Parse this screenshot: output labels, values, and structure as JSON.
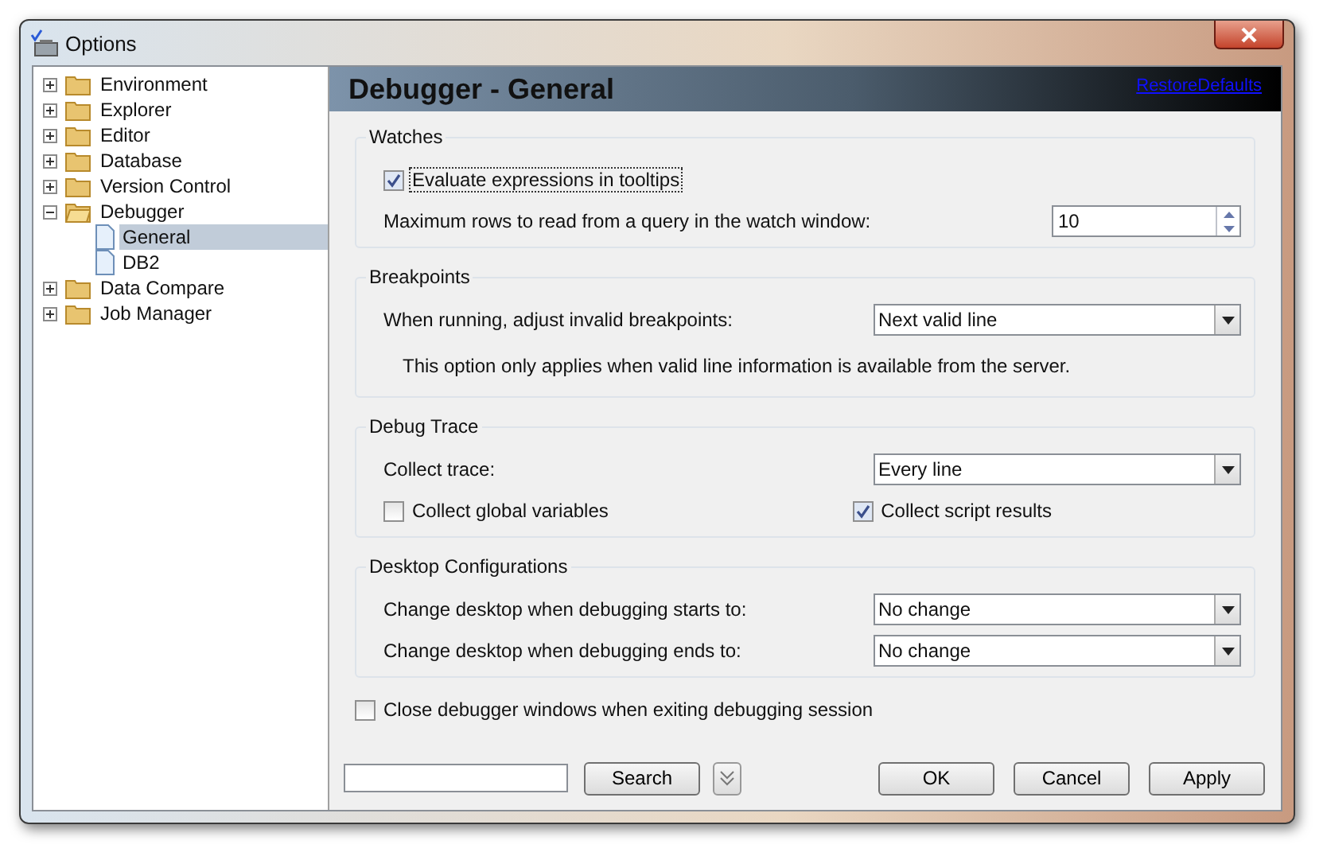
{
  "window": {
    "title": "Options"
  },
  "tree": [
    {
      "label": "Environment",
      "kind": "folder",
      "expanded": false,
      "selected": false
    },
    {
      "label": "Explorer",
      "kind": "folder",
      "expanded": false,
      "selected": false
    },
    {
      "label": "Editor",
      "kind": "folder",
      "expanded": false,
      "selected": false
    },
    {
      "label": "Database",
      "kind": "folder",
      "expanded": false,
      "selected": false
    },
    {
      "label": "Version Control",
      "kind": "folder",
      "expanded": false,
      "selected": false
    },
    {
      "label": "Debugger",
      "kind": "folder",
      "expanded": true,
      "selected": false,
      "children": [
        {
          "label": "General",
          "kind": "page",
          "selected": true
        },
        {
          "label": "DB2",
          "kind": "page",
          "selected": false
        }
      ]
    },
    {
      "label": "Data Compare",
      "kind": "folder",
      "expanded": false,
      "selected": false
    },
    {
      "label": "Job Manager",
      "kind": "folder",
      "expanded": false,
      "selected": false
    }
  ],
  "page": {
    "title": "Debugger - General",
    "link": "RestoreDefaults"
  },
  "groups": [
    {
      "title": "Watches",
      "rows": [
        {
          "kind": "checkbox",
          "label": "Evaluate expressions in tooltips",
          "checked": true,
          "focused": true
        },
        {
          "kind": "spin",
          "label": "Maximum rows to read from a query in the watch window:",
          "value": "10"
        }
      ]
    },
    {
      "title": "Breakpoints",
      "rows": [
        {
          "kind": "select",
          "label": "When running, adjust invalid breakpoints:",
          "value": "Next valid line"
        },
        {
          "kind": "note",
          "text": "This option only applies when valid line information is available from the server."
        }
      ]
    },
    {
      "title": "Debug Trace",
      "rows": [
        {
          "kind": "select",
          "label": "Collect trace:",
          "value": "Every line"
        },
        {
          "kind": "checkboxes",
          "items": [
            {
              "label": "Collect global variables",
              "checked": false
            },
            {
              "label": "Collect script results",
              "checked": true
            }
          ]
        }
      ]
    },
    {
      "title": "Desktop Configurations",
      "rows": [
        {
          "kind": "select",
          "label": "Change desktop when debugging starts to:",
          "value": "No change"
        },
        {
          "kind": "select",
          "label": "Change desktop when debugging ends to:",
          "value": "No change"
        }
      ]
    }
  ],
  "close_option": {
    "label": "Close debugger windows when exiting debugging session",
    "checked": false
  },
  "search_button": "Search",
  "buttons": [
    "OK",
    "Cancel",
    "Apply"
  ]
}
